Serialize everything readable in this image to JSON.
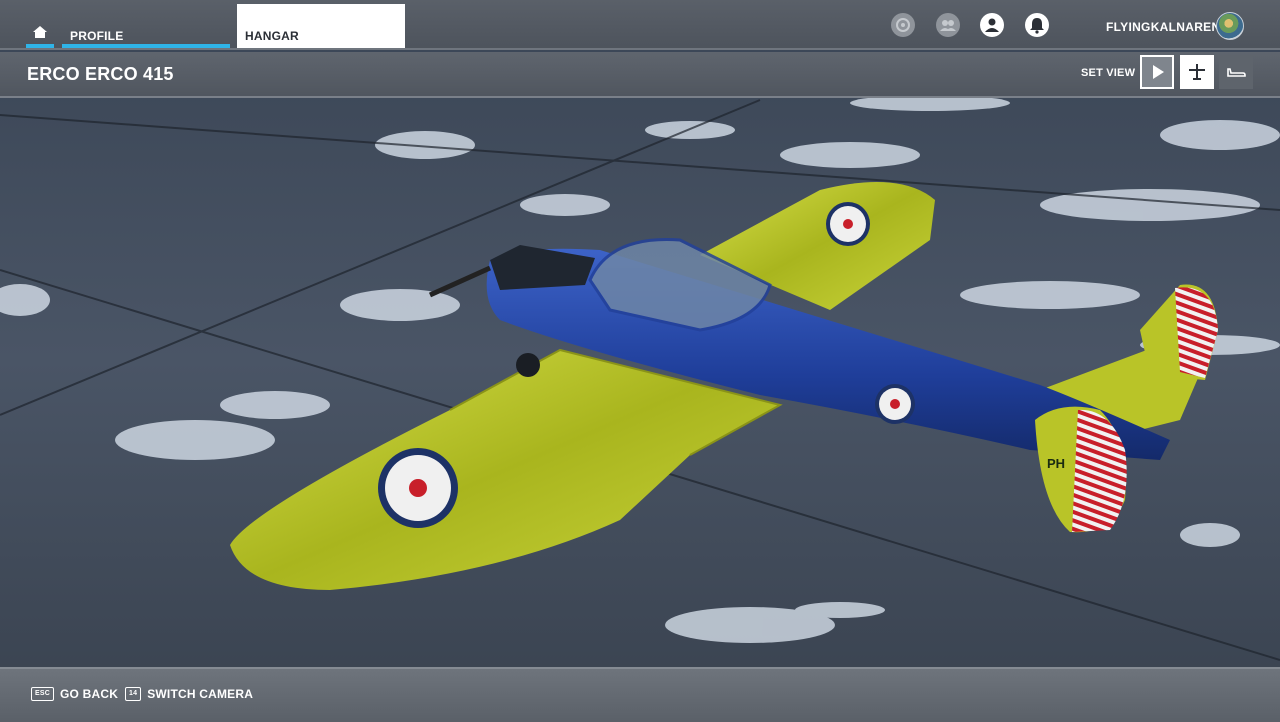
{
  "nav": {
    "home_icon": "home-icon",
    "tabs": [
      {
        "label": "PROFILE",
        "active": true
      },
      {
        "label": "HANGAR",
        "selected": true
      }
    ],
    "accent_color": "#2fb4e8"
  },
  "top_icons": [
    "news-icon",
    "friends-icon",
    "profile-icon",
    "notifications-icon"
  ],
  "user": {
    "name": "FLYINGKALNAREN"
  },
  "title": "ERCO ERCO 415",
  "view": {
    "label": "SET VIEW",
    "buttons": [
      "play-icon",
      "top-view-icon",
      "side-view-icon"
    ]
  },
  "aircraft": {
    "registration": "PH"
  },
  "bottom": {
    "hints": [
      {
        "key": "ESC",
        "label": "GO BACK"
      },
      {
        "key": "14",
        "label": "SWITCH CAMERA"
      }
    ]
  }
}
